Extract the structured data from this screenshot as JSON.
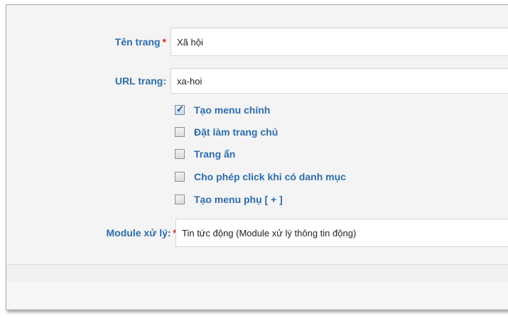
{
  "form": {
    "page_name": {
      "label": "Tên trang",
      "required_mark": "*",
      "value": "Xã hội"
    },
    "page_url": {
      "label": "URL trang:",
      "value": "xa-hoi"
    },
    "options": [
      {
        "label": "Tạo menu chính",
        "checked": true
      },
      {
        "label": "Đặt làm trang chủ",
        "checked": false
      },
      {
        "label": "Trang ẩn",
        "checked": false
      },
      {
        "label": "Cho phép click khi có danh mục",
        "checked": false
      },
      {
        "label": "Tạo menu phụ [ + ]",
        "checked": false
      }
    ],
    "module": {
      "label": "Module xử lý:",
      "required_mark": "*",
      "value": "Tin tức động (Module xử lý thông tin động)"
    }
  },
  "colors": {
    "label": "#2d6dab",
    "required": "#d32323"
  }
}
